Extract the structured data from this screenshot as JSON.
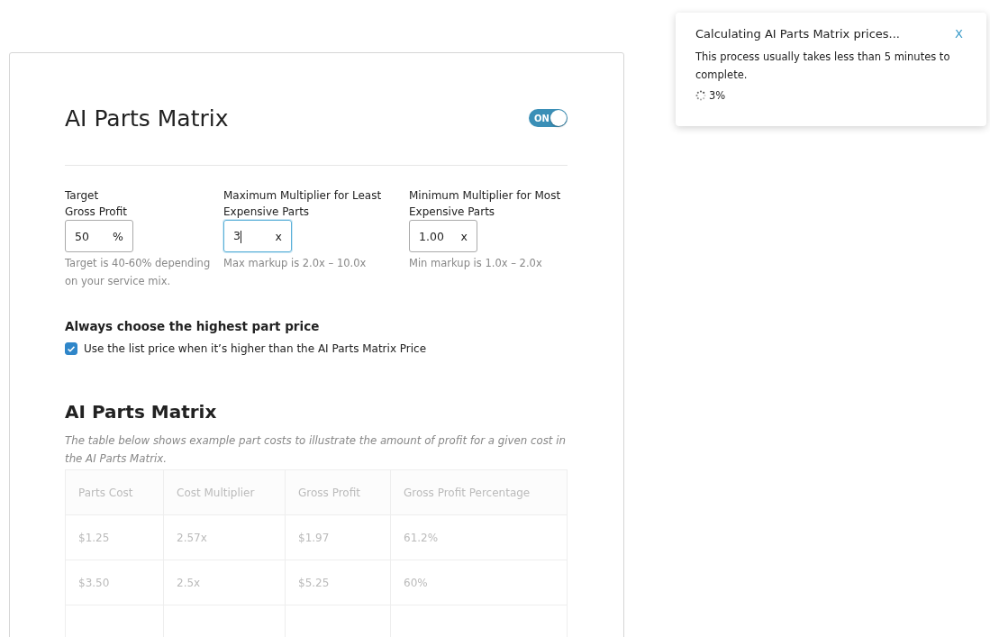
{
  "settings": {
    "title": "AI Parts Matrix",
    "toggle": {
      "label": "ON",
      "on": true
    },
    "fields": [
      {
        "label": "Target\nGross Profit",
        "value": "50",
        "suffix": "%",
        "focused": false,
        "hint": "Target is 40-60% depending on your service mix."
      },
      {
        "label": "Maximum Multiplier for Least Expensive Parts",
        "value": "3",
        "suffix": "x",
        "focused": true,
        "hint": "Max markup is 2.0x – 10.0x"
      },
      {
        "label": "Minimum Multiplier for Most Expensive Parts",
        "value": "1.00",
        "suffix": "x",
        "focused": false,
        "hint": "Min markup is 1.0x – 2.0x"
      }
    ],
    "option": {
      "heading": "Always choose the highest part price",
      "label": "Use the list price when it’s higher than the AI Parts Matrix Price",
      "checked": true
    }
  },
  "matrix": {
    "title": "AI Parts Matrix",
    "description": "The table below shows example part costs to illustrate the amount of profit for a given cost in the AI Parts Matrix.",
    "disabled": true,
    "columns": [
      "Parts Cost",
      "Cost Multiplier",
      "Gross Profit",
      "Gross Profit Percentage"
    ],
    "rows": [
      [
        "$1.25",
        "2.57x",
        "$1.97",
        "61.2%"
      ],
      [
        "$3.50",
        "2.5x",
        "$5.25",
        "60%"
      ]
    ]
  },
  "toast": {
    "title": "Calculating AI Parts Matrix prices...",
    "message": "This process usually takes less than 5 minutes to complete.",
    "progress": "3%",
    "close": "X"
  }
}
